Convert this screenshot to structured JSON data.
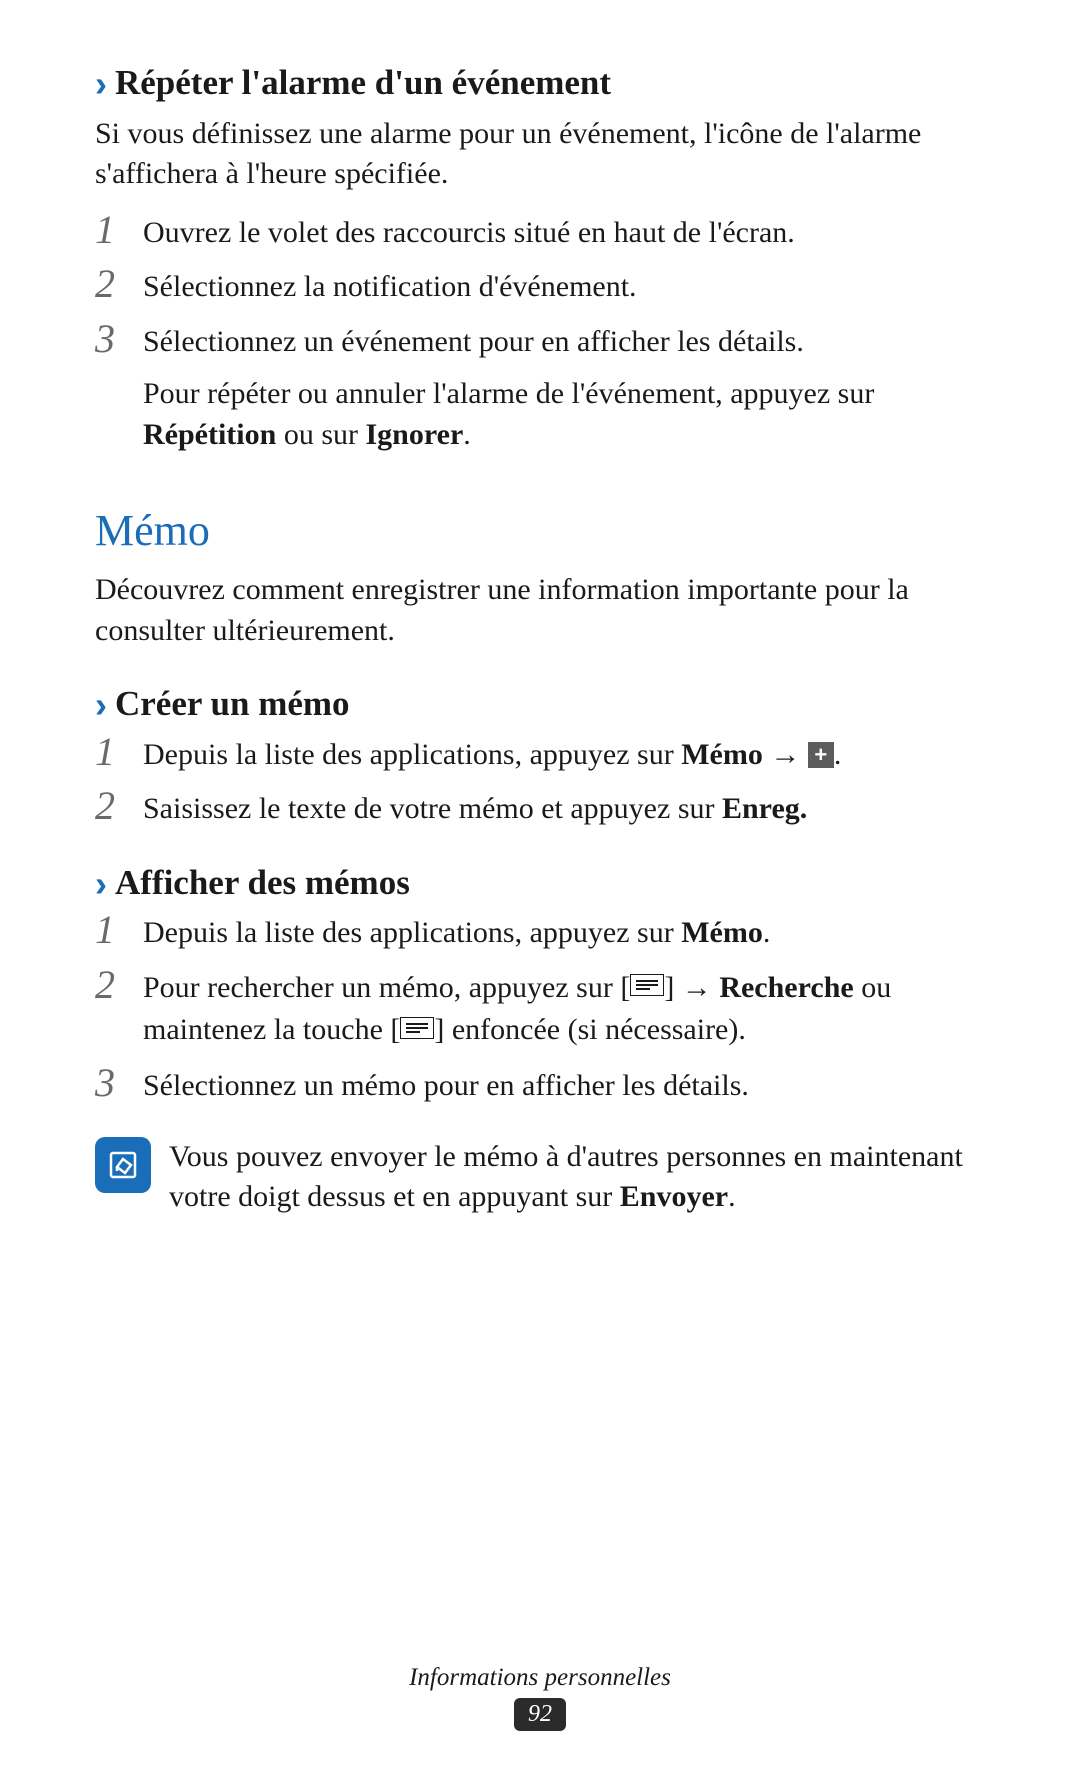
{
  "sections": {
    "repeat_alarm": {
      "title": "Répéter l'alarme d'un événement",
      "desc": "Si vous définissez une alarme pour un événement, l'icône de l'alarme s'affichera à l'heure spécifiée.",
      "steps": [
        {
          "num": "1",
          "text": "Ouvrez le volet des raccourcis situé en haut de l'écran."
        },
        {
          "num": "2",
          "text": "Sélectionnez la notification d'événement."
        },
        {
          "num": "3",
          "text": "Sélectionnez un événement pour en afficher les détails.",
          "sub_pre": "Pour répéter ou annuler l'alarme de l'événement, appuyez sur ",
          "sub_bold1": "Répétition",
          "sub_mid": " ou sur ",
          "sub_bold2": "Ignorer",
          "sub_post": "."
        }
      ]
    },
    "memo": {
      "heading": "Mémo",
      "desc": "Découvrez comment enregistrer une information importante pour la consulter ultérieurement."
    },
    "create_memo": {
      "title": "Créer un mémo",
      "steps": [
        {
          "num": "1",
          "pre": "Depuis la liste des applications, appuyez sur ",
          "bold": "Mémo",
          "post": " → ",
          "icon": "plus",
          "tail": "."
        },
        {
          "num": "2",
          "pre": "Saisissez le texte de votre mémo et appuyez sur ",
          "bold": "Enreg."
        }
      ]
    },
    "view_memos": {
      "title": "Afficher des mémos",
      "steps": [
        {
          "num": "1",
          "pre": "Depuis la liste des applications, appuyez sur ",
          "bold": "Mémo",
          "post": "."
        },
        {
          "num": "2",
          "pre": "Pour rechercher un mémo, appuyez sur [",
          "icon1": "menu",
          "mid1": "] → ",
          "bold": "Recherche",
          "mid2": " ou maintenez la touche [",
          "icon2": "menu",
          "post": "] enfoncée (si nécessaire)."
        },
        {
          "num": "3",
          "text": "Sélectionnez un mémo pour en afficher les détails."
        }
      ],
      "note": {
        "pre": "Vous pouvez envoyer le mémo à d'autres personnes en maintenant votre doigt dessus et en appuyant sur ",
        "bold": "Envoyer",
        "post": "."
      }
    }
  },
  "footer": {
    "label": "Informations personnelles",
    "page": "92"
  }
}
